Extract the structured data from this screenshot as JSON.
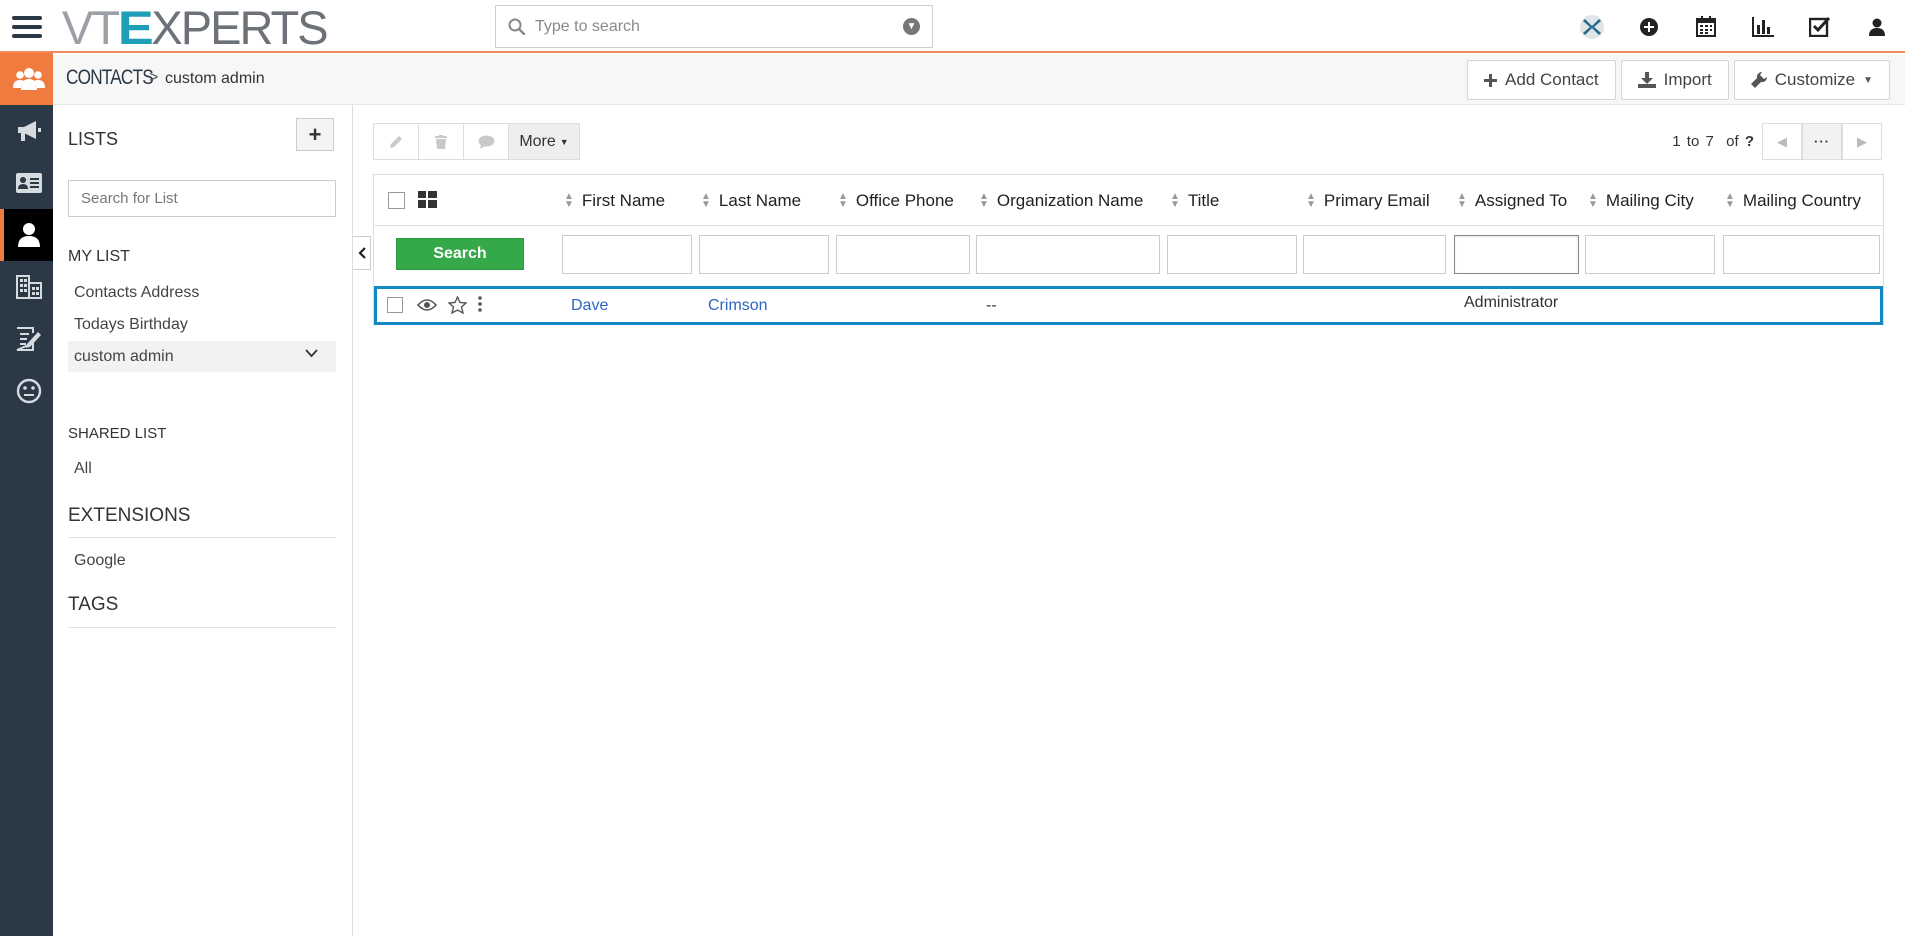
{
  "app": {
    "logo_text": "VTEXPERTS",
    "search_placeholder": "Type to search"
  },
  "top_icons": [
    "vtexperts-icon",
    "plus-circle-icon",
    "calendar-icon",
    "bar-chart-icon",
    "checkbox-icon",
    "user-icon"
  ],
  "left_rail": [
    {
      "name": "contacts-group-icon",
      "state": "orange"
    },
    {
      "name": "megaphone-icon",
      "state": "normal"
    },
    {
      "name": "id-card-icon",
      "state": "normal"
    },
    {
      "name": "user-icon",
      "state": "active"
    },
    {
      "name": "building-icon",
      "state": "normal"
    },
    {
      "name": "edit-document-icon",
      "state": "normal"
    },
    {
      "name": "neutral-face-icon",
      "state": "normal"
    }
  ],
  "breadcrumb": {
    "module": "CONTACTS",
    "separator": ">",
    "list": "custom admin"
  },
  "header_actions": {
    "add": "Add Contact",
    "import": "Import",
    "customize": "Customize"
  },
  "sidebar": {
    "lists_title": "LISTS",
    "add_symbol": "+",
    "search_placeholder": "Search for List",
    "my_list_title": "MY LIST",
    "my_list": [
      "Contacts Address",
      "Todays Birthday",
      "custom admin"
    ],
    "shared_title": "SHARED LIST",
    "shared_list": [
      "All"
    ],
    "extensions_title": "EXTENSIONS",
    "extensions": [
      "Google"
    ],
    "tags_title": "TAGS"
  },
  "toolbar": {
    "more": "More"
  },
  "pager": {
    "range": "1 to 7",
    "of": "of",
    "total": "?",
    "dots": "···"
  },
  "table": {
    "columns": [
      "First Name",
      "Last Name",
      "Office Phone",
      "Organization Name",
      "Title",
      "Primary Email",
      "Assigned To",
      "Mailing City",
      "Mailing Country"
    ],
    "search_button": "Search",
    "rows": [
      {
        "first_name": "Dave",
        "last_name": "Crimson",
        "office_phone": "",
        "organization_name": "--",
        "title": "",
        "primary_email": "",
        "assigned_to": "Administrator",
        "mailing_city": "",
        "mailing_country": ""
      }
    ]
  },
  "colors": {
    "rail_bg": "#2b3846",
    "accent_orange": "#f07b3f",
    "search_green": "#35a849",
    "row_highlight": "#1288c4",
    "link_blue": "#2a66c5"
  }
}
